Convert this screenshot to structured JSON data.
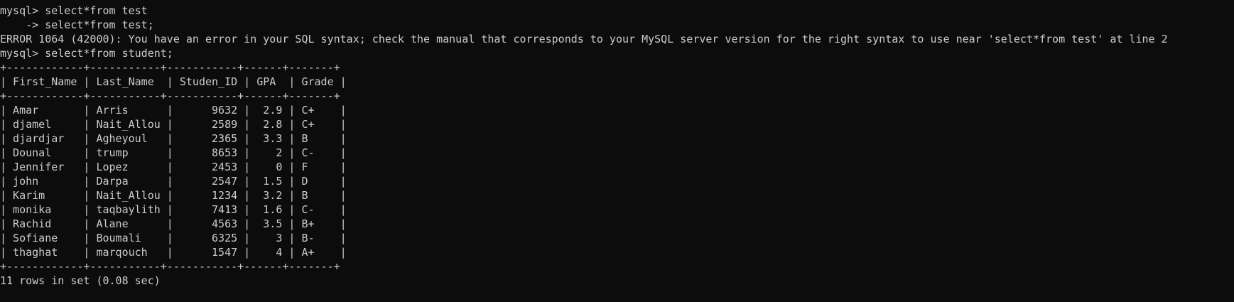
{
  "terminal": {
    "lines": [
      "mysql> select*from test",
      "    -> select*from test;",
      "ERROR 1064 (42000): You have an error in your SQL syntax; check the manual that corresponds to your MySQL server version for the right syntax to use near 'select*from test' at line 2",
      "mysql> select*from student;",
      "+------------+-----------+-----------+------+-------+",
      "| First_Name | Last_Name  | Studen_ID | GPA  | Grade |",
      "+------------+-----------+-----------+------+-------+",
      "| Amar       | Arris      |      9632 |  2.9 | C+    |",
      "| djamel     | Nait_Allou |      2589 |  2.8 | C+    |",
      "| djardjar   | Agheyoul   |      2365 |  3.3 | B     |",
      "| Dounal     | trump      |      8653 |    2 | C-    |",
      "| Jennifer   | Lopez      |      2453 |    0 | F     |",
      "| john       | Darpa      |      2547 |  1.5 | D     |",
      "| Karim      | Nait_Allou |      1234 |  3.2 | B     |",
      "| monika     | taqbaylith |      7413 |  1.6 | C-    |",
      "| Rachid     | Alane      |      4563 |  3.5 | B+    |",
      "| Sofiane    | Boumali    |      6325 |    3 | B-    |",
      "| thaghat    | marqouch   |      1547 |    4 | A+    |",
      "+------------+-----------+-----------+------+-------+",
      "11 rows in set (0.08 sec)"
    ]
  }
}
